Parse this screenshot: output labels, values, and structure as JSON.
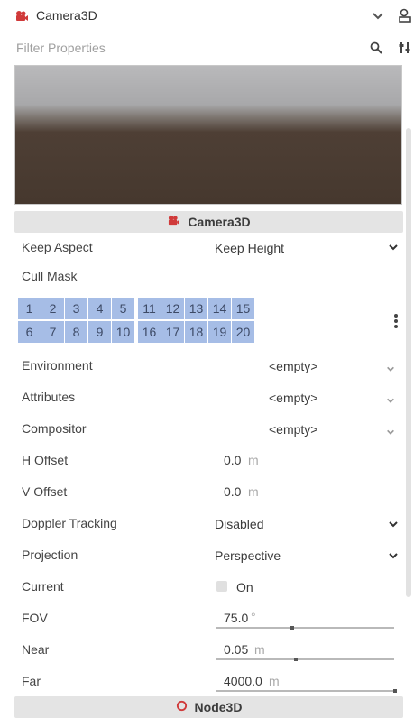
{
  "header": {
    "title": "Camera3D"
  },
  "filter": {
    "placeholder": "Filter Properties"
  },
  "section_camera": {
    "label": "Camera3D"
  },
  "section_node": {
    "label": "Node3D"
  },
  "props": {
    "keep_aspect": {
      "label": "Keep Aspect",
      "value": "Keep Height"
    },
    "cull_mask": {
      "label": "Cull Mask",
      "layers": [
        "1",
        "2",
        "3",
        "4",
        "5",
        "11",
        "12",
        "13",
        "14",
        "15",
        "6",
        "7",
        "8",
        "9",
        "10",
        "16",
        "17",
        "18",
        "19",
        "20"
      ]
    },
    "environment": {
      "label": "Environment",
      "value": "<empty>"
    },
    "attributes": {
      "label": "Attributes",
      "value": "<empty>"
    },
    "compositor": {
      "label": "Compositor",
      "value": "<empty>"
    },
    "h_offset": {
      "label": "H Offset",
      "value": "0.0",
      "unit": "m"
    },
    "v_offset": {
      "label": "V Offset",
      "value": "0.0",
      "unit": "m"
    },
    "doppler": {
      "label": "Doppler Tracking",
      "value": "Disabled"
    },
    "projection": {
      "label": "Projection",
      "value": "Perspective"
    },
    "current": {
      "label": "Current",
      "value": "On",
      "checked": false
    },
    "fov": {
      "label": "FOV",
      "value": "75.0",
      "unit": "°",
      "slider_fraction": 0.42
    },
    "near": {
      "label": "Near",
      "value": "0.05",
      "unit": "m",
      "slider_fraction": 0.44
    },
    "far": {
      "label": "Far",
      "value": "4000.0",
      "unit": "m",
      "slider_fraction": 1.0
    }
  },
  "colors": {
    "layer_bg": "#a6bde6",
    "camera_icon": "#d03a3a",
    "node_icon": "#d03a3a"
  }
}
